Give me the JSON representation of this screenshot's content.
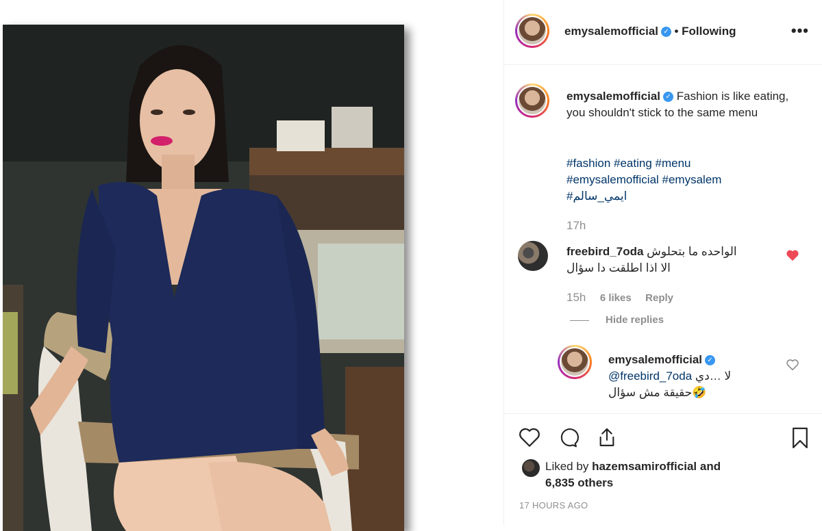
{
  "post": {
    "username": "emysalemofficial",
    "follow_status": "• Following",
    "more_label": "•••",
    "verified_badge": "✓"
  },
  "caption": {
    "username": "emysalemofficial",
    "text": "Fashion is like eating, you shouldn't stick to the same menu",
    "tags_line1": "#fashion #eating #menu",
    "tags_line2": "#emysalemofficial #emysalem",
    "tags_line3": "#ايمي_سالم",
    "time": "17h"
  },
  "comment": {
    "username": "freebird_7oda",
    "text_line1": "الواحده ما بتحلوش",
    "text_line2": "الا اذا اطلقت دا سؤال",
    "time": "15h",
    "likes": "6 likes",
    "reply_label": "Reply",
    "hide_replies_label": "Hide replies",
    "liked": true
  },
  "reply": {
    "username": "emysalemofficial",
    "mention": "@freebird_7oda",
    "text_line1": "لا …دي",
    "text_line2": "🤣حقيقة مش سؤال"
  },
  "likes": {
    "prefix": "Liked by",
    "user": "hazemsamirofficial",
    "suffix": "and",
    "others": "6,835 others"
  },
  "timestamp": "17 HOURS AGO",
  "colors": {
    "link": "#003569",
    "muted": "#8e8e8e",
    "like_red": "#ed4956",
    "verified_blue": "#3897f0"
  },
  "icons": [
    "heart-icon",
    "comment-icon",
    "share-icon",
    "bookmark-icon",
    "more-icon",
    "verified-icon"
  ]
}
